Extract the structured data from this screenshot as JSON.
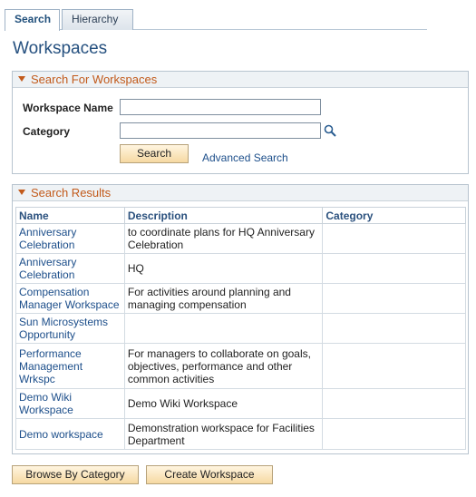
{
  "tabs": [
    {
      "label": "Search",
      "active": true
    },
    {
      "label": "Hierarchy",
      "active": false
    }
  ],
  "page_title": "Workspaces",
  "search_section": {
    "title": "Search For Workspaces",
    "workspace_name_label": "Workspace Name",
    "workspace_name_value": "",
    "category_label": "Category",
    "category_value": "",
    "lookup_icon": "magnifier-icon",
    "search_button": "Search",
    "advanced_search_link": "Advanced Search"
  },
  "results_section": {
    "title": "Search Results",
    "columns": [
      "Name",
      "Description",
      "Category"
    ],
    "rows": [
      {
        "name": "Anniversary Celebration",
        "description": "to coordinate plans for HQ Anniversary Celebration",
        "category": ""
      },
      {
        "name": "Anniversary Celebration",
        "description": "HQ",
        "category": ""
      },
      {
        "name": "Compensation Manager Workspace",
        "description": "For activities around planning and managing compensation",
        "category": ""
      },
      {
        "name": "Sun Microsystems Opportunity",
        "description": "",
        "category": ""
      },
      {
        "name": "Performance Management Wrkspc",
        "description": "For managers to collaborate on goals, objectives, performance and other common activities",
        "category": ""
      },
      {
        "name": "Demo Wiki Workspace",
        "description": "Demo Wiki Workspace",
        "category": ""
      },
      {
        "name": "Demo workspace",
        "description": "Demonstration workspace for Facilities Department",
        "category": ""
      }
    ]
  },
  "buttons": {
    "browse_by_category": "Browse By Category",
    "create_workspace": "Create Workspace"
  }
}
